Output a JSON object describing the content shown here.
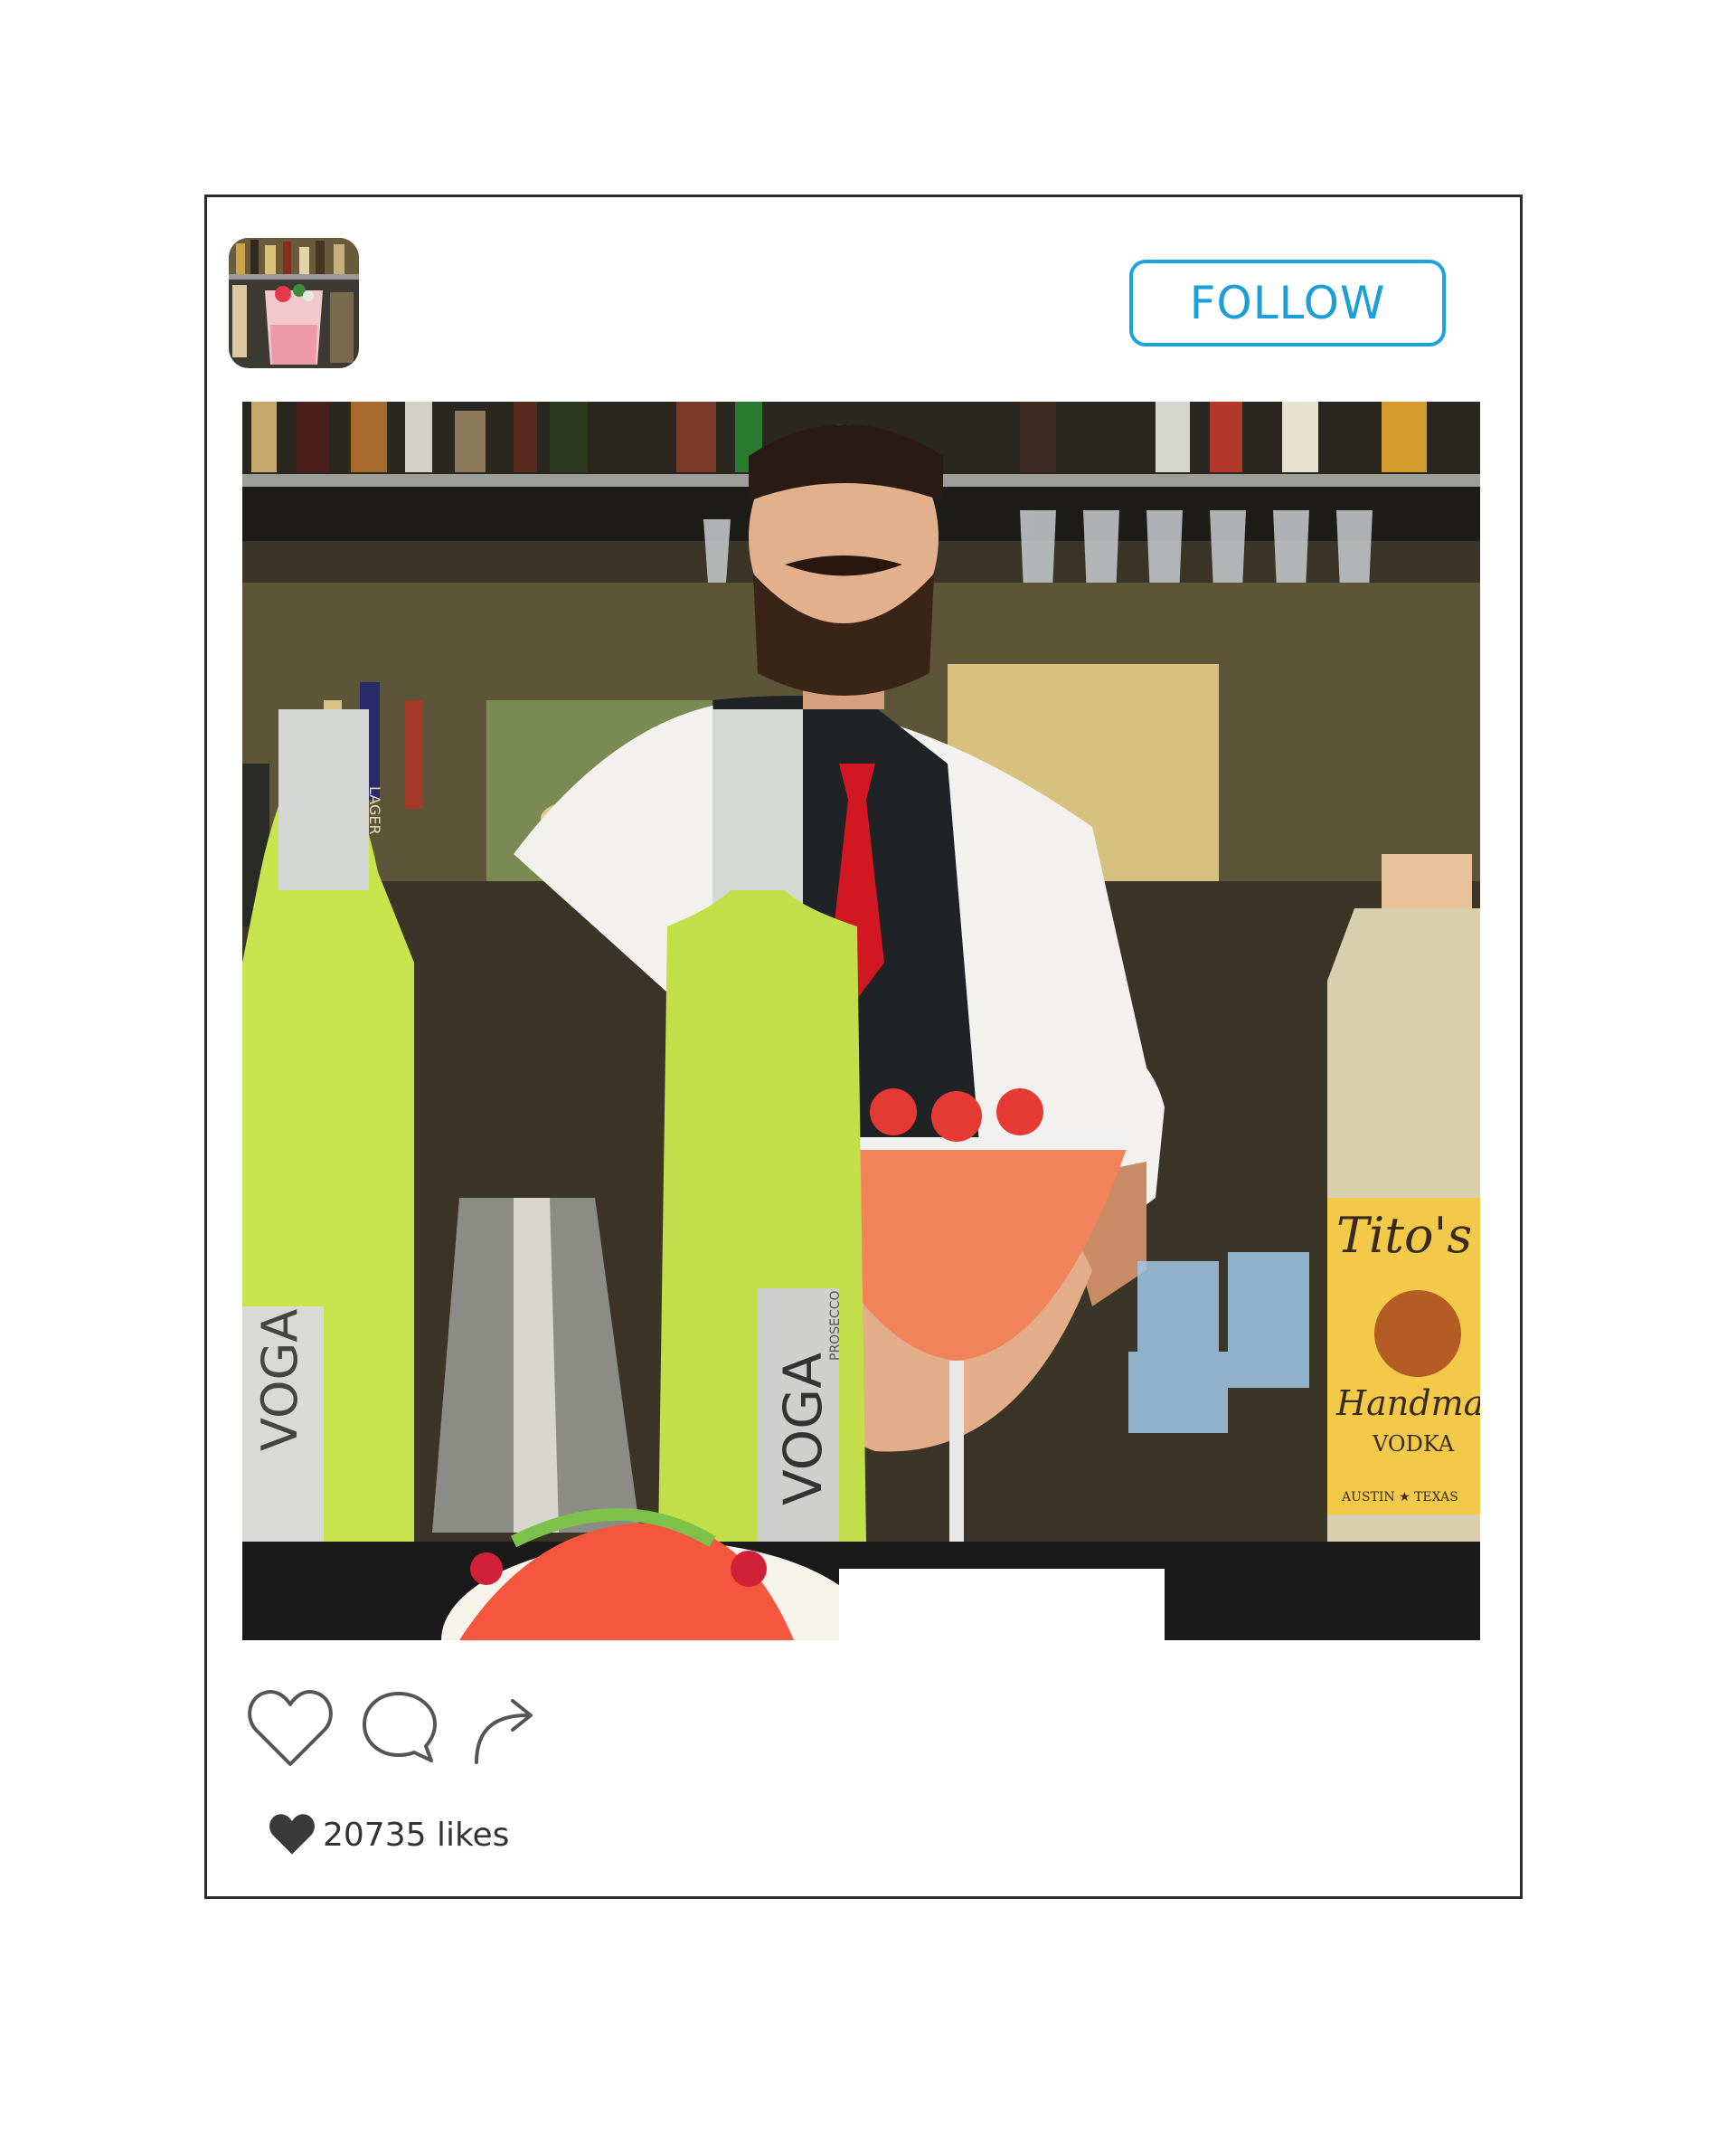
{
  "post": {
    "follow_label": "FOLLOW",
    "likes_text": "20735 likes"
  },
  "photo_text": {
    "voga_brand": "VOGA",
    "voga_sub": "PROSECCO",
    "titos_brand": "Tito's",
    "titos_line": "Handmade",
    "titos_vodka": "VODKA",
    "titos_city": "AUSTIN ★ TEXAS",
    "tap_lager": "LAGER"
  },
  "colors": {
    "follow_accent": "#1aa3dd",
    "icon_stroke": "#555555",
    "likes_heart": "#3a3a3a"
  },
  "icons": {
    "like": "heart-outline-icon",
    "comment": "speech-bubble-icon",
    "share": "share-arrow-icon",
    "likes_heart": "heart-filled-icon"
  }
}
